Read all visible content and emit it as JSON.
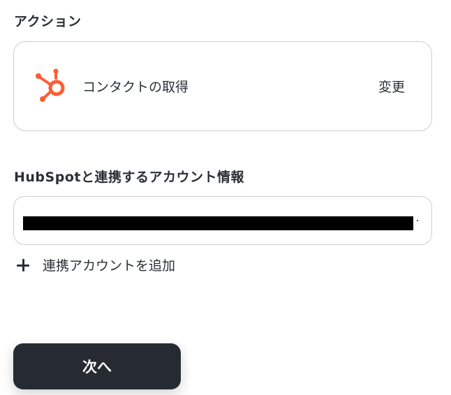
{
  "action_section": {
    "label": "アクション",
    "action_name": "コンタクトの取得",
    "change_label": "変更",
    "icon": "hubspot-logo",
    "icon_color": "#ff5c35"
  },
  "account_section": {
    "label": "HubSpotと連携するアカウント情報",
    "add_account_label": "連携アカウントを追加"
  },
  "footer": {
    "next_label": "次へ"
  }
}
